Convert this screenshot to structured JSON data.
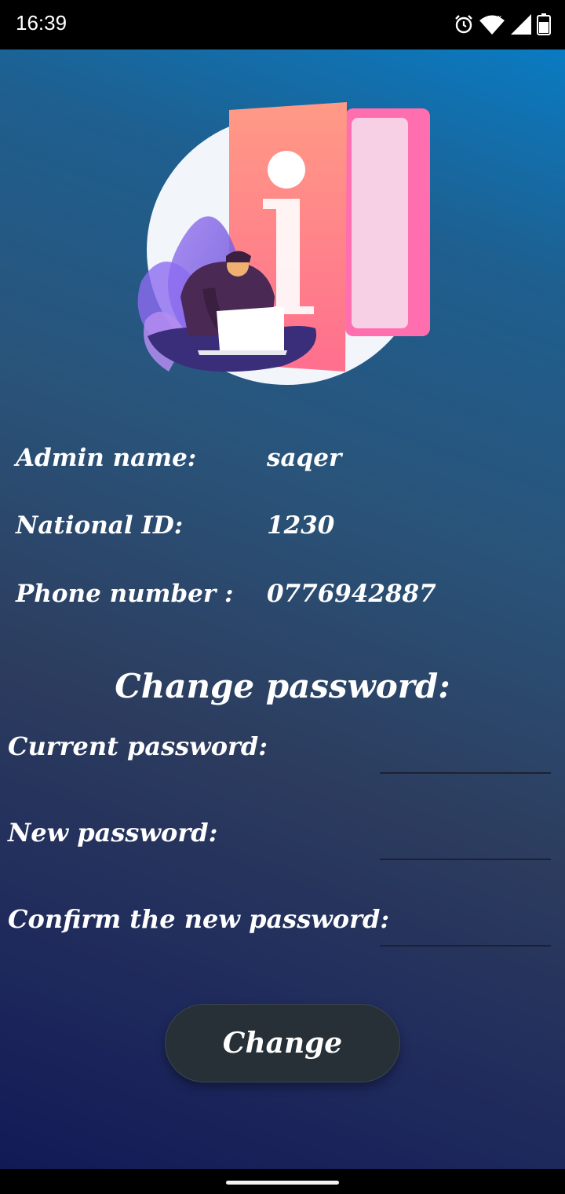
{
  "status_bar": {
    "time": "16:39",
    "icons": [
      "alarm-icon",
      "wifi-icon",
      "signal-icon",
      "battery-icon"
    ]
  },
  "illustration": {
    "letter": "i",
    "icon": "info-folder-illustration"
  },
  "admin": {
    "name_label": "Admin name:",
    "name_value": "saqer",
    "national_id_label": "National ID:",
    "national_id_value": "1230",
    "phone_label": "Phone number :",
    "phone_value": "0776942887"
  },
  "change_password": {
    "title": "Change password:",
    "current_label": "Current password:",
    "current_value": "",
    "new_label": "New password:",
    "new_value": "",
    "confirm_label": "Confirm the new password:",
    "confirm_value": "",
    "button_label": "Change"
  },
  "colors": {
    "gradient_top": "#0a7bc2",
    "gradient_bottom": "#121a56",
    "button_bg": "#263036",
    "text": "#ffffff"
  }
}
